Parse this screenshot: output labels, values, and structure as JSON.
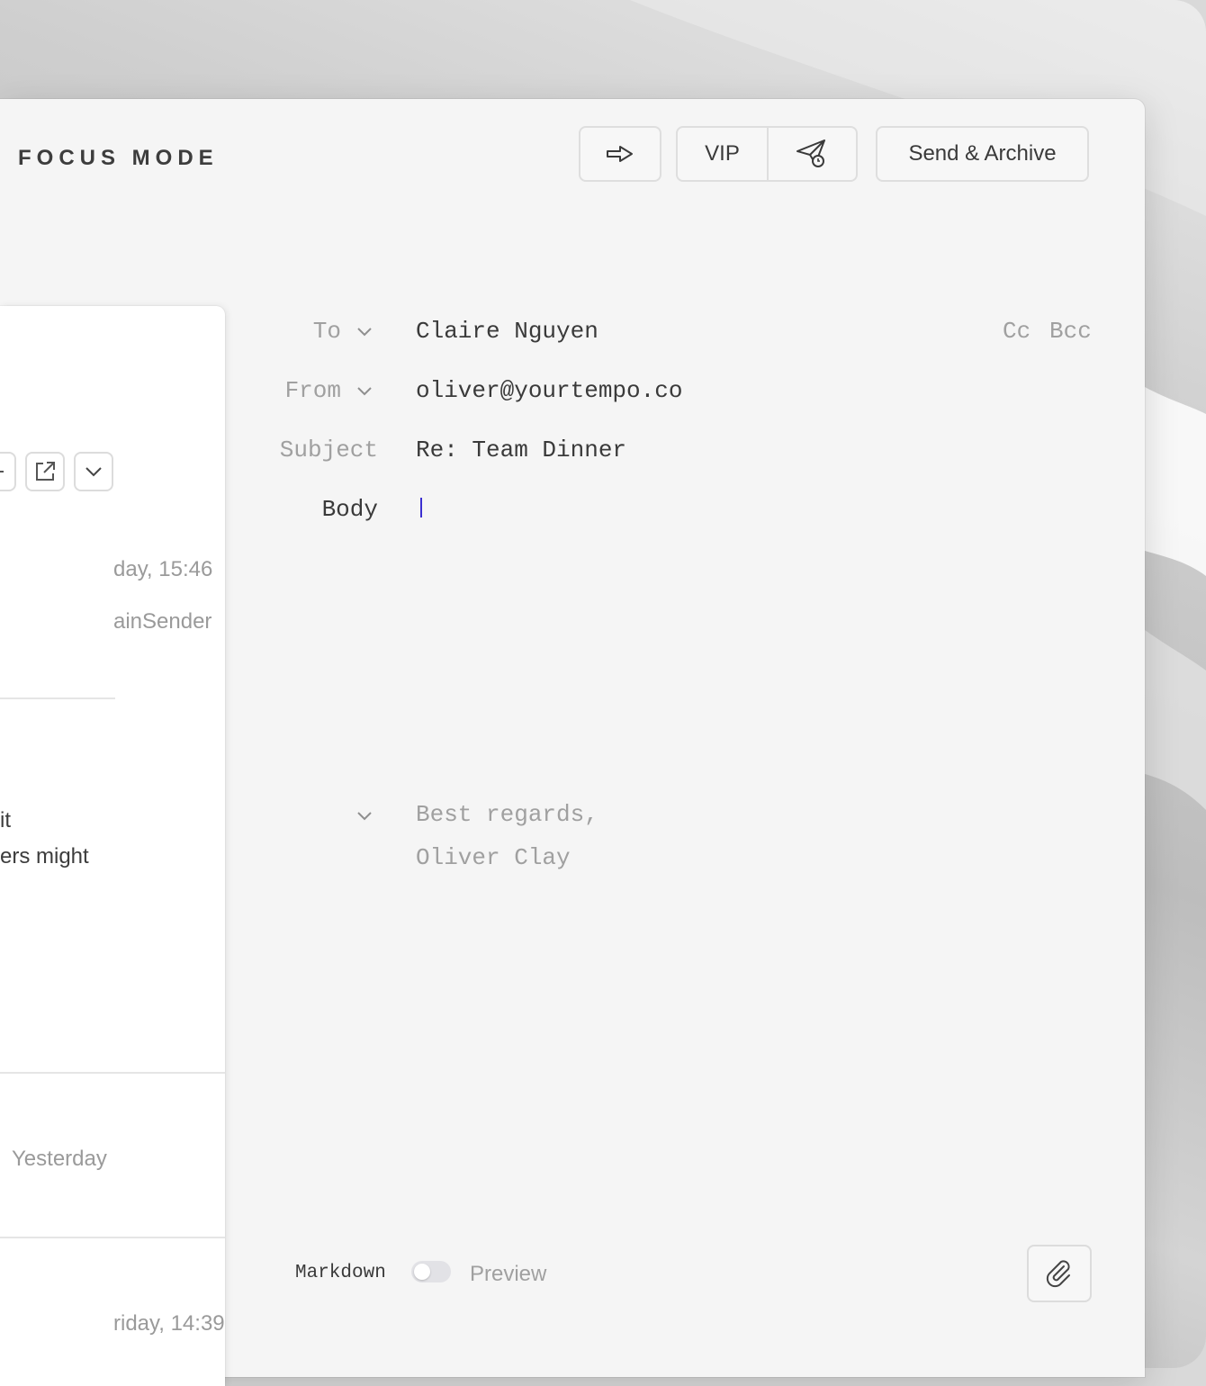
{
  "toolbar": {
    "title": "FOCUS MODE",
    "vip_label": "VIP",
    "send_archive_label": "Send & Archive",
    "icons": [
      "forward-arrow-icon",
      "send-later-icon"
    ]
  },
  "left_panel": {
    "date_1": "day, 15:46",
    "sender_1": "ainSender",
    "body_line_1": "it",
    "body_line_2": "ers might",
    "date_2": "Yesterday",
    "date_3": "riday, 14:39",
    "icons": [
      "reply-icon",
      "external-link-icon",
      "chevron-down-icon"
    ]
  },
  "compose": {
    "to_label": "To",
    "to_value": "Claire Nguyen",
    "cc_label": "Cc",
    "bcc_label": "Bcc",
    "from_label": "From",
    "from_value": "oliver@yourtempo.co",
    "subject_label": "Subject",
    "subject_value": "Re: Team Dinner",
    "body_label": "Body",
    "body_value": "",
    "signature_line_1": "Best regards,",
    "signature_line_2": "Oliver Clay"
  },
  "footer": {
    "markdown_label": "Markdown",
    "preview_label": "Preview",
    "toggle_on": false
  },
  "colors": {
    "cursor": "#3b2fd0",
    "window_bg": "#f5f5f5"
  }
}
